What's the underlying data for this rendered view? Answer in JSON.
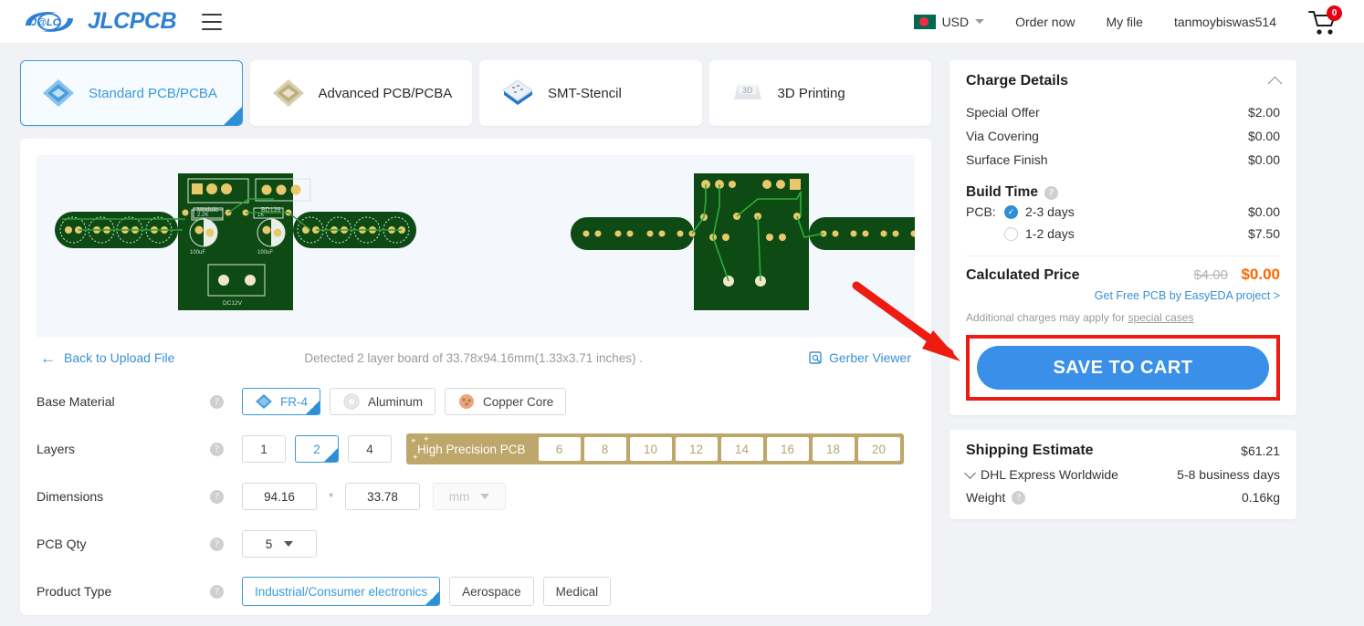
{
  "header": {
    "logo_mark": "jlc-logo-icon",
    "brand": "JLCPCB",
    "menu_icon": "hamburger-menu-icon",
    "currency": "USD",
    "flag": "bangladesh-flag-icon",
    "nav": [
      {
        "label": "Order now"
      },
      {
        "label": "My file"
      },
      {
        "label": "tanmoybiswas514"
      }
    ],
    "cart_icon": "shopping-cart-icon",
    "cart_count": "0"
  },
  "tabs": [
    {
      "label": "Standard PCB/PCBA",
      "icon": "standard-pcb-icon",
      "active": true
    },
    {
      "label": "Advanced PCB/PCBA",
      "icon": "advanced-pcb-icon",
      "active": false
    },
    {
      "label": "SMT-Stencil",
      "icon": "smt-stencil-icon",
      "active": false
    },
    {
      "label": "3D Printing",
      "icon": "3d-printing-icon",
      "active": false
    }
  ],
  "preview": {
    "back_link": "Back to Upload File",
    "back_icon": "arrow-left-icon",
    "detected": "Detected 2 layer board of 33.78x94.16mm(1.33x3.71 inches) .",
    "gerber_viewer": "Gerber Viewer",
    "gerber_icon": "gerber-viewer-icon"
  },
  "form": {
    "base_material": {
      "label": "Base Material",
      "options": [
        {
          "label": "FR-4",
          "icon": "fr4-icon",
          "selected": true
        },
        {
          "label": "Aluminum",
          "icon": "aluminum-icon",
          "selected": false
        },
        {
          "label": "Copper Core",
          "icon": "copper-core-icon",
          "selected": false
        }
      ]
    },
    "layers": {
      "label": "Layers",
      "options": [
        {
          "label": "1",
          "selected": false
        },
        {
          "label": "2",
          "selected": true
        },
        {
          "label": "4",
          "selected": false
        }
      ],
      "high_precision_label": "High Precision PCB",
      "high_precision_options": [
        "6",
        "8",
        "10",
        "12",
        "14",
        "16",
        "18",
        "20"
      ]
    },
    "dimensions": {
      "label": "Dimensions",
      "width": "94.16",
      "separator": "*",
      "height": "33.78",
      "unit": "mm"
    },
    "pcb_qty": {
      "label": "PCB Qty",
      "value": "5"
    },
    "product_type": {
      "label": "Product Type",
      "options": [
        {
          "label": "Industrial/Consumer electronics",
          "selected": true
        },
        {
          "label": "Aerospace",
          "selected": false
        },
        {
          "label": "Medical",
          "selected": false
        }
      ]
    }
  },
  "charge_details": {
    "title": "Charge Details",
    "collapse_icon": "chevron-up-icon",
    "rows": [
      {
        "label": "Special Offer",
        "value": "$2.00"
      },
      {
        "label": "Via Covering",
        "value": "$0.00"
      },
      {
        "label": "Surface Finish",
        "value": "$0.00"
      }
    ],
    "build_time": {
      "title": "Build Time",
      "pcb_label": "PCB:",
      "options": [
        {
          "label": "2-3 days",
          "price": "$0.00",
          "selected": true
        },
        {
          "label": "1-2 days",
          "price": "$7.50",
          "selected": false
        }
      ]
    },
    "calculated": {
      "label": "Calculated Price",
      "old_price": "$4.00",
      "new_price": "$0.00"
    },
    "free_pcb_link": "Get Free PCB by EasyEDA project >",
    "additional_text": "Additional charges may apply for ",
    "additional_link": "special cases",
    "save_to_cart": "SAVE TO CART"
  },
  "shipping": {
    "title": "Shipping Estimate",
    "price": "$61.21",
    "carrier": "DHL Express Worldwide",
    "carrier_icon": "chevron-down-icon",
    "days": "5-8 business days",
    "weight_label": "Weight",
    "weight_value": "0.16kg"
  },
  "colors": {
    "brand_blue": "#2f7fd4",
    "accent_blue": "#3a90e8",
    "price_orange": "#ff6600",
    "highlight_red": "#ee1b11",
    "gold": "#bda76a",
    "pcb_green": "#0d4a14"
  }
}
